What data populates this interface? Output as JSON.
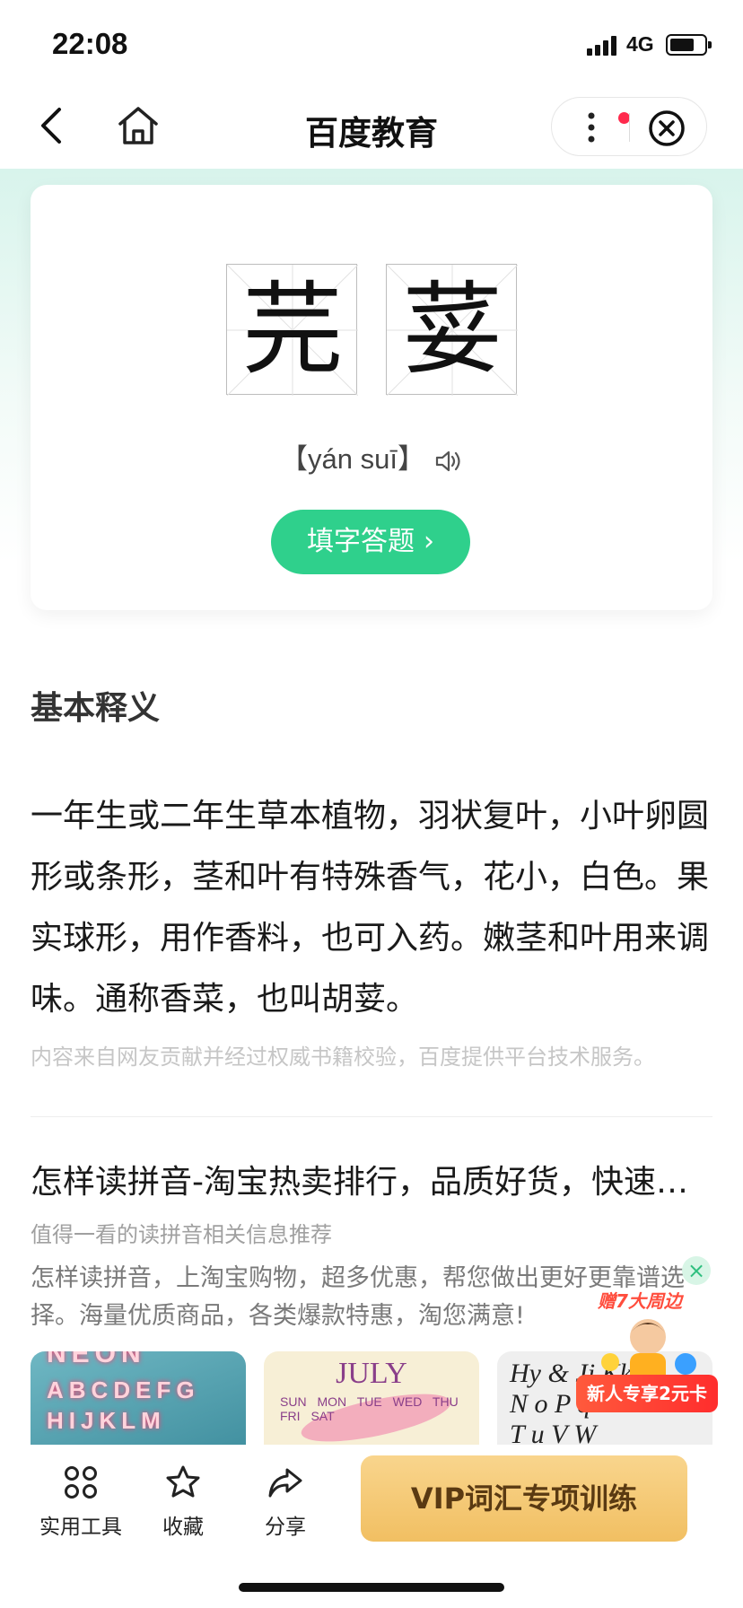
{
  "status_bar": {
    "time": "22:08",
    "network": "4G"
  },
  "nav": {
    "title": "百度教育"
  },
  "hero": {
    "characters": [
      "芫",
      "荽"
    ],
    "pinyin": "【yán suī】",
    "fill_button": "填字答题"
  },
  "definition": {
    "section_title": "基本释义",
    "text": "一年生或二年生草本植物，羽状复叶，小叶卵圆形或条形，茎和叶有特殊香气，花小，白色。果实球形，用作香料，也可入药。嫩茎和叶用来调味。通称香菜，也叫胡荽。",
    "source": "内容来自网友贡献并经过权威书籍校验，百度提供平台技术服务。"
  },
  "ad": {
    "title": "怎样读拼音-淘宝热卖排行，品质好货，快速…",
    "subtitle": "值得一看的读拼音相关信息推荐",
    "description": "怎样读拼音，上淘宝购物，超多优惠，帮您做出更好更靠谱选择。海量优质商品，各类爆款特惠，淘您满意!",
    "thumb1_lines": [
      "NEON",
      "ABCDEFG",
      "HIJKLM"
    ],
    "thumb2_month": "JULY",
    "thumb2_weekdays": "SUN MON TUE WED THU FRI SAT",
    "thumb3_text": "Hy & Jj Kk\nN o P q\nT u V W"
  },
  "promo": {
    "headline": "赠7大周边",
    "banner": "新人专享2元卡",
    "close_glyph": "×"
  },
  "bottom_bar": {
    "tools_label": "实用工具",
    "favorite_label": "收藏",
    "share_label": "分享",
    "vip_label": "VIP词汇专项训练"
  },
  "colors": {
    "accent_green": "#2fd08c",
    "vip_gold": "#f1bf62",
    "red_dot": "#ff2a4d"
  }
}
